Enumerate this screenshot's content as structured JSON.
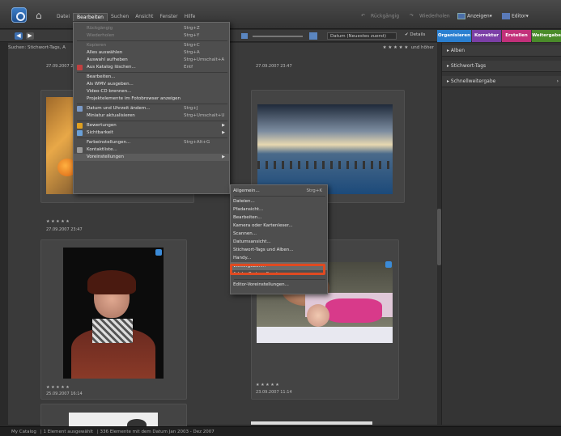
{
  "menubar": {
    "items": [
      "Datei",
      "Bearbeiten",
      "Suchen",
      "Ansicht",
      "Fenster",
      "Hilfe"
    ],
    "active": "Bearbeiten"
  },
  "titlebar_right": {
    "undo": "Rückgängig",
    "redo": "Wiederholen",
    "display": "Anzeigen",
    "editor": "Editor"
  },
  "toolbar": {
    "sort": "Datum (Neuestes zuerst)",
    "details": "Details"
  },
  "tabs": [
    {
      "label": "Organisieren",
      "color": "#2a7fd0"
    },
    {
      "label": "Korrektur",
      "color": "#7b3fa6"
    },
    {
      "label": "Erstellen",
      "color": "#c2307a"
    },
    {
      "label": "Weitergabe",
      "color": "#4a8b2a"
    }
  ],
  "search": {
    "label": "Suchen: Stichwort-Tags, A",
    "rating": "★ ★ ★ ★ ★",
    "rating_suffix": "und höher"
  },
  "photos": [
    {
      "date": "27.09.2007 23:47"
    },
    {
      "date": "27.09.2007 23:47"
    },
    {
      "date": "27.09.2007 23:47"
    },
    {
      "date": "25.09.2007 16:14"
    },
    {
      "date": "23.09.2007 11:14"
    }
  ],
  "stars": "★ ★ ★ ★ ★",
  "edit_menu": [
    {
      "label": "Rückgängig",
      "shortcut": "Strg+Z",
      "disabled": true
    },
    {
      "label": "Wiederholen",
      "shortcut": "Strg+Y",
      "disabled": true
    },
    {
      "sep": true
    },
    {
      "label": "Kopieren",
      "shortcut": "Strg+C",
      "disabled": true
    },
    {
      "label": "Alles auswählen",
      "shortcut": "Strg+A"
    },
    {
      "label": "Auswahl aufheben",
      "shortcut": "Strg+Umschalt+A"
    },
    {
      "label": "Aus Katalog löschen...",
      "shortcut": "Entf",
      "icon": "#c24040"
    },
    {
      "sep": true
    },
    {
      "label": "Bearbeiten..."
    },
    {
      "label": "Als WMV ausgeben..."
    },
    {
      "label": "Video-CD brennen..."
    },
    {
      "label": "Projektelemente im Fotobrowser anzeigen"
    },
    {
      "sep": true
    },
    {
      "label": "Datum und Uhrzeit ändern...",
      "shortcut": "Strg+J",
      "icon": "#7a9ac8"
    },
    {
      "label": "Miniatur aktualisieren",
      "shortcut": "Strg+Umschalt+U"
    },
    {
      "sep": true
    },
    {
      "label": "Bewertungen",
      "submenu": true,
      "icon": "#e0a020"
    },
    {
      "label": "Sichtbarkeit",
      "submenu": true,
      "icon": "#6aa0d8"
    },
    {
      "sep": true
    },
    {
      "label": "Farbeinstellungen...",
      "shortcut": "Strg+Alt+G"
    },
    {
      "label": "Kontaktliste...",
      "icon": "#9a9a9a"
    },
    {
      "label": "Voreinstellungen",
      "submenu": true
    }
  ],
  "preferences_submenu": [
    {
      "label": "Allgemein...",
      "shortcut": "Strg+K"
    },
    {
      "sep": true
    },
    {
      "label": "Dateien..."
    },
    {
      "label": "Pfadansicht..."
    },
    {
      "label": "Bearbeiten..."
    },
    {
      "label": "Kamera oder Kartenleser..."
    },
    {
      "label": "Scannen..."
    },
    {
      "label": "Datumsansicht..."
    },
    {
      "label": "Stichwort-Tags und Alben..."
    },
    {
      "label": "Handy..."
    },
    {
      "label": "Weitergeben...",
      "highlighted": true
    },
    {
      "label": "Adobe Partner-Services..."
    },
    {
      "sep": true
    },
    {
      "label": "Editor-Voreinstellungen..."
    }
  ],
  "right_panel": {
    "headers": [
      "Alben",
      "Stichwort-Tags",
      "Schnellweitergabe"
    ]
  },
  "statusbar": {
    "catalog": "My Catalog",
    "selected": "1 Element ausgewählt",
    "elements": "336 Elemente mit dem Datum Jan 2003 - Dez 2007"
  }
}
